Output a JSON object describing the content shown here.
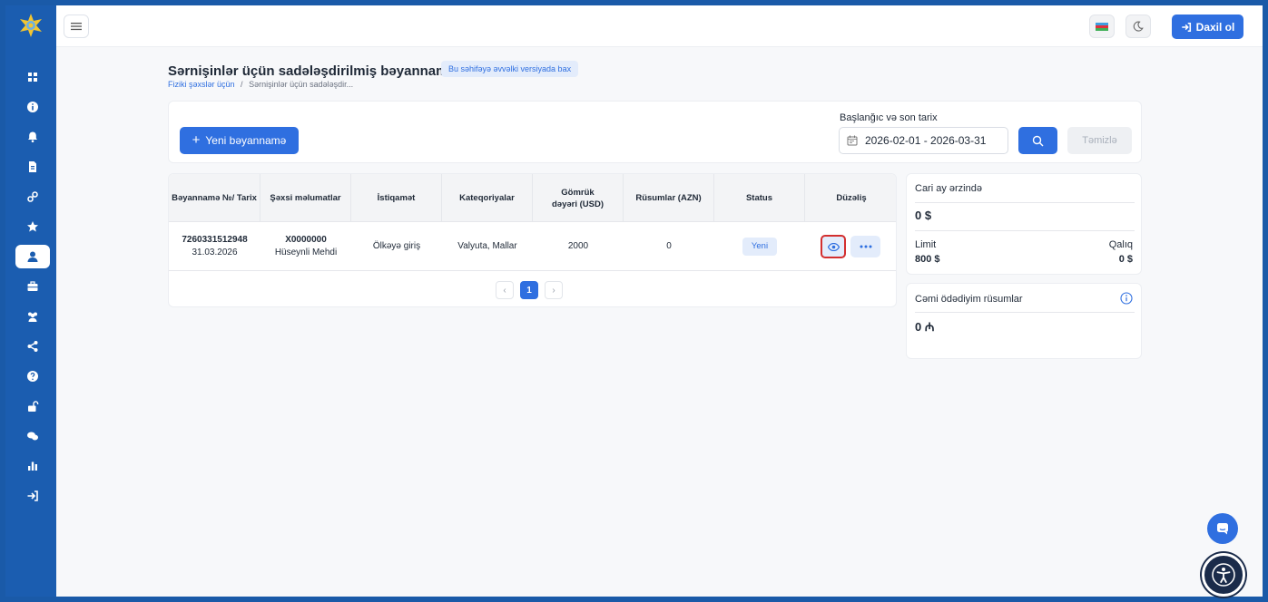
{
  "topbar": {
    "login_label": "Daxil ol"
  },
  "colors": {
    "brand_blue": "#2f6fe0",
    "sidebar_blue": "#1b5db0",
    "highlight_red": "#d32f2f"
  },
  "sidebar": {
    "items": [
      {
        "icon": "dashboard-icon"
      },
      {
        "icon": "info-icon"
      },
      {
        "icon": "bell-icon"
      },
      {
        "icon": "document-icon"
      },
      {
        "icon": "link-icon"
      },
      {
        "icon": "star-icon"
      },
      {
        "icon": "user-icon",
        "active": true
      },
      {
        "icon": "briefcase-icon"
      },
      {
        "icon": "users-icon"
      },
      {
        "icon": "share-icon"
      },
      {
        "icon": "question-icon"
      },
      {
        "icon": "unlock-icon"
      },
      {
        "icon": "chat-icon"
      },
      {
        "icon": "bar-chart-icon"
      },
      {
        "icon": "sign-in-icon"
      }
    ]
  },
  "page": {
    "title": "Sərnişinlər üçün sadələşdirilmiş bəyannamə",
    "badge": "Bu səhifəyə əvvəlki versiyada bax",
    "breadcrumb": {
      "parent": "Fiziki şəxslər üçün",
      "separator": "/",
      "current": "Sərnişinlər üçün sadələşdir..."
    }
  },
  "filter": {
    "new_button": "Yeni bəyannamə",
    "date_label": "Başlanğıc və son tarix",
    "date_value": "2026-02-01 - 2026-03-31",
    "clear_button": "Təmizlə"
  },
  "table": {
    "headers": [
      "Bəyannamə №/ Tarix",
      "Şəxsi məlumatlar",
      "İstiqamət",
      "Kateqoriyalar",
      "Gömrük dəyəri (USD)",
      "Rüsumlar (AZN)",
      "Status",
      "Düzəliş"
    ],
    "rows": [
      {
        "number": "7260331512948",
        "date": "31.03.2026",
        "person_id": "X0000000",
        "person_name": "Hüseynli Mehdi",
        "direction": "Ölkəyə giriş",
        "categories": "Valyuta, Mallar",
        "customs_value": "2000",
        "duties": "0",
        "status": "Yeni"
      }
    ],
    "pagination": {
      "prev": "‹",
      "current": "1",
      "next": "›"
    }
  },
  "summary": {
    "month_label": "Cari ay ərzində",
    "month_value": "0 $",
    "limit_label": "Limit",
    "limit_value": "800 $",
    "remaining_label": "Qalıq",
    "remaining_value": "0 $"
  },
  "duties_card": {
    "label": "Cəmi ödədiyim rüsumlar",
    "value": "0 ₼"
  }
}
